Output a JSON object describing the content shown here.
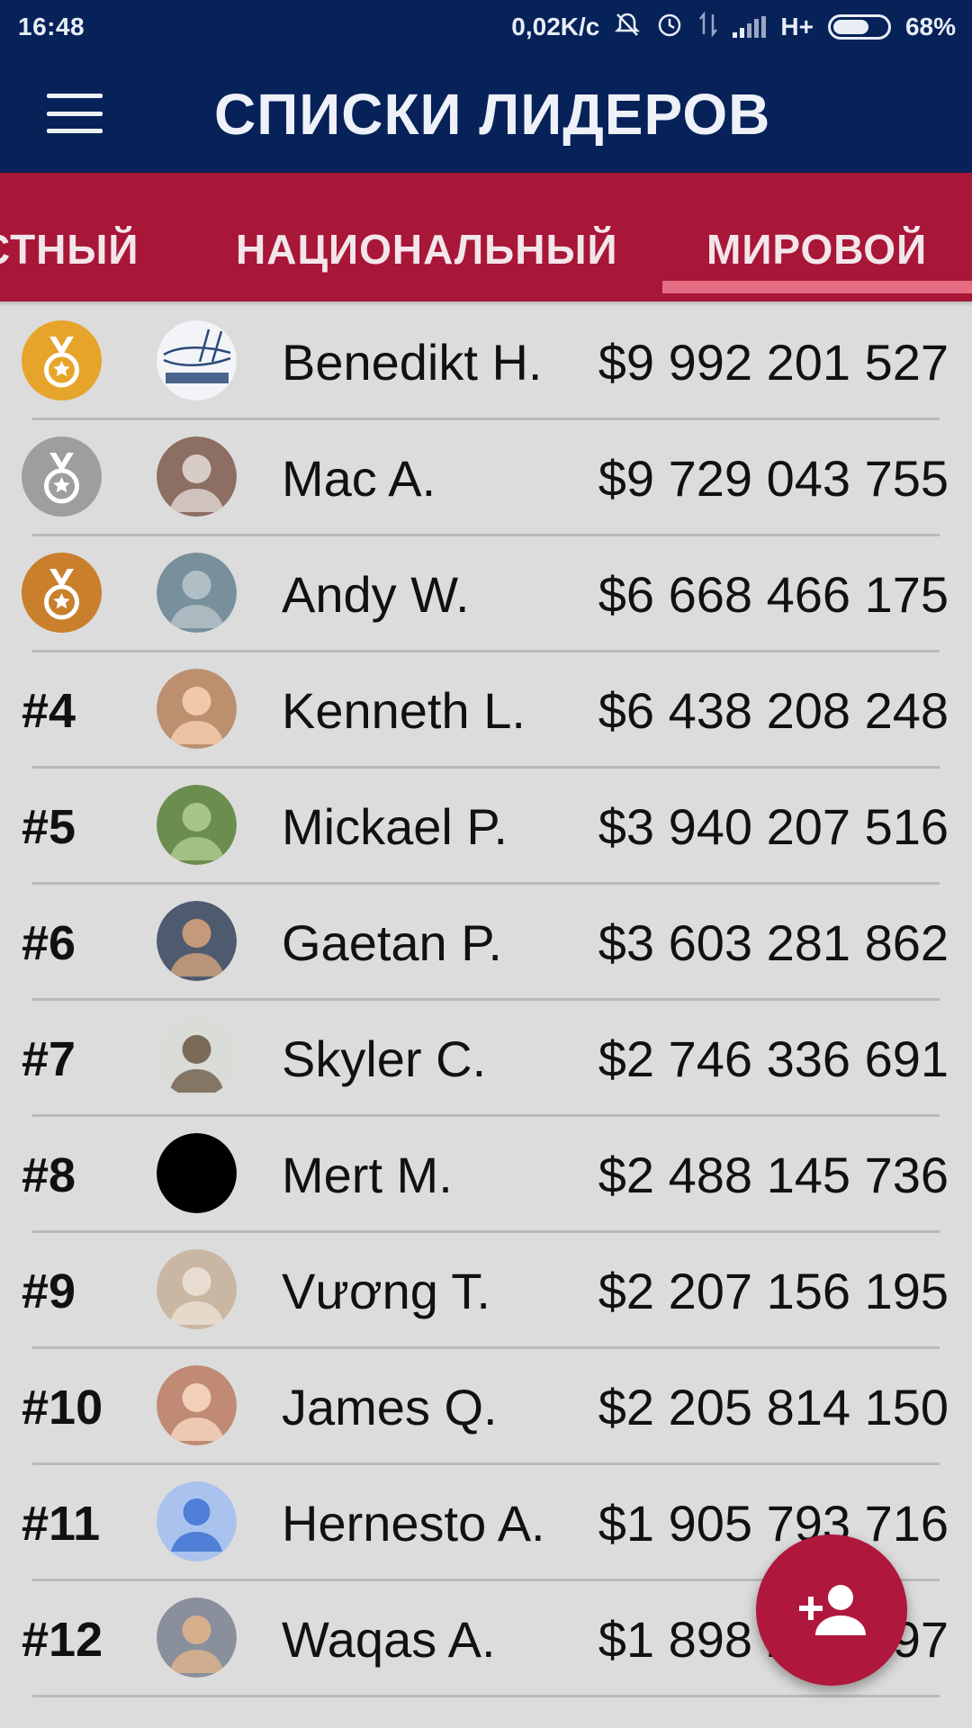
{
  "status_bar": {
    "time": "16:48",
    "net_speed": "0,02K/c",
    "network_type": "H+",
    "battery": "68%",
    "battery_level": 0.68,
    "icons": [
      "mute-bell-icon",
      "alarm-icon",
      "data-arrows-icon",
      "signal-icon",
      "battery-icon"
    ]
  },
  "app_bar": {
    "title": "СПИСКИ ЛИДЕРОВ",
    "menu_icon": "menu-icon"
  },
  "tabs": [
    {
      "label": "МЕСТНЫЙ",
      "visible_text": "СТНЫЙ",
      "selected": false
    },
    {
      "label": "НАЦИОНАЛЬНЫЙ",
      "visible_text": "НАЦИОНАЛЬНЫЙ",
      "selected": false
    },
    {
      "label": "МИРОВОЙ",
      "visible_text": "МИРОВОЙ",
      "selected": true
    }
  ],
  "leaderboard": [
    {
      "rank": "#1",
      "medal": "gold",
      "name": "Benedikt H.",
      "value": "$9 992 201 527",
      "avatar": "halter-logo"
    },
    {
      "rank": "#2",
      "medal": "silver",
      "name": "Mac A.",
      "value": "$9 729 043 755",
      "avatar": "photo"
    },
    {
      "rank": "#3",
      "medal": "bronze",
      "name": "Andy W.",
      "value": "$6 668 466 175",
      "avatar": "photo"
    },
    {
      "rank": "#4",
      "medal": "",
      "name": "Kenneth L.",
      "value": "$6 438 208 248",
      "avatar": "photo"
    },
    {
      "rank": "#5",
      "medal": "",
      "name": "Mickael P.",
      "value": "$3 940 207 516",
      "avatar": "photo"
    },
    {
      "rank": "#6",
      "medal": "",
      "name": "Gaetan P.",
      "value": "$3 603 281 862",
      "avatar": "photo"
    },
    {
      "rank": "#7",
      "medal": "",
      "name": "Skyler C.",
      "value": "$2 746 336 691",
      "avatar": "photo"
    },
    {
      "rank": "#8",
      "medal": "",
      "name": "Mert M.",
      "value": "$2 488 145 736",
      "avatar": "black"
    },
    {
      "rank": "#9",
      "medal": "",
      "name": "Vương T.",
      "value": "$2 207 156 195",
      "avatar": "photo"
    },
    {
      "rank": "#10",
      "medal": "",
      "name": "James Q.",
      "value": "$2 205 814 150",
      "avatar": "photo"
    },
    {
      "rank": "#11",
      "medal": "",
      "name": "Hernesto A.",
      "value": "$1 905 793 716",
      "avatar": "default-person"
    },
    {
      "rank": "#12",
      "medal": "",
      "name": "Waqas A.",
      "value": "$1 898 297 297",
      "avatar": "photo"
    }
  ],
  "fab": {
    "icon": "add-person-icon"
  },
  "colors": {
    "header": "#062259",
    "tabs": "#a81638",
    "tab_indicator": "#e56d83",
    "list_bg": "#dcdcdc",
    "fab": "#b0173d",
    "gold": "#e6a52a",
    "silver": "#9e9e9e",
    "bronze": "#c97f2c"
  }
}
